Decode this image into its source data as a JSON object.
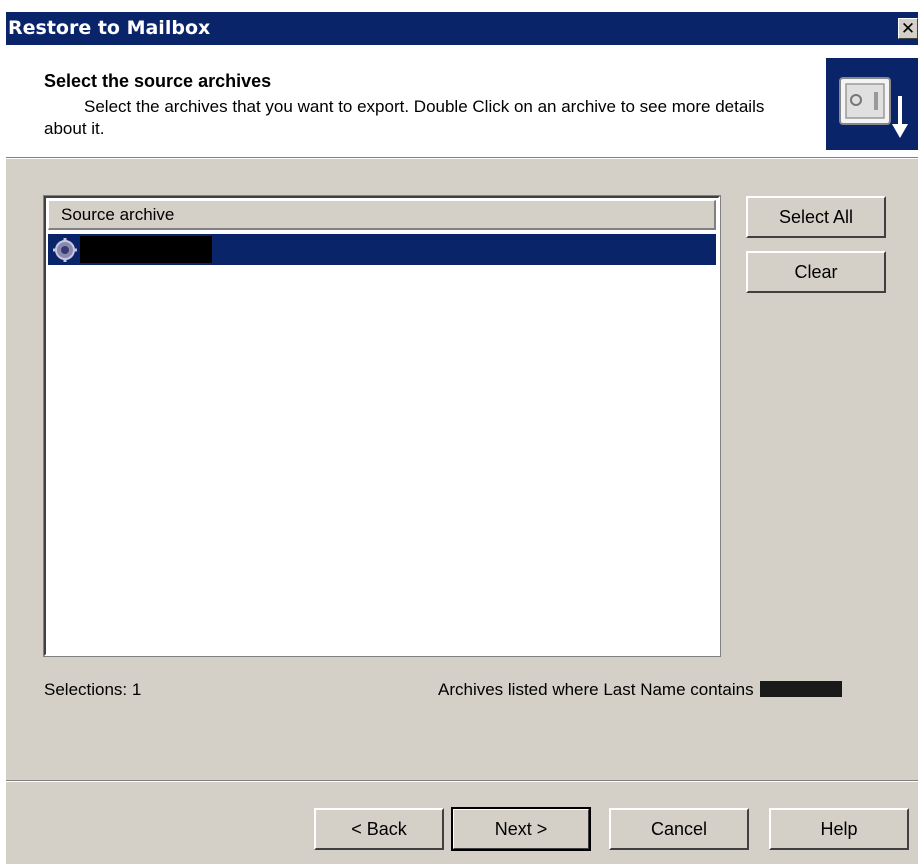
{
  "window": {
    "title": "Restore to Mailbox",
    "close_glyph": "✕"
  },
  "header": {
    "title": "Select the source archives",
    "description": "Select the archives that you want to export. Double Click on an archive to see more details about it.",
    "icon": "vault-restore-icon"
  },
  "list": {
    "column_header": "Source archive",
    "rows": [
      {
        "icon": "archive-gear-icon",
        "name_redacted": true,
        "selected": true
      }
    ]
  },
  "side_buttons": {
    "select_all": "Select All",
    "clear": "Clear"
  },
  "status": {
    "selections": "Selections: 1",
    "filter_text": "Archives listed where Last Name contains"
  },
  "footer": {
    "back": "< Back",
    "next": "Next >",
    "cancel": "Cancel",
    "help": "Help"
  },
  "colors": {
    "title_bar": "#0a246a",
    "dialog_face": "#d4d0c8",
    "selection": "#0a246a"
  }
}
